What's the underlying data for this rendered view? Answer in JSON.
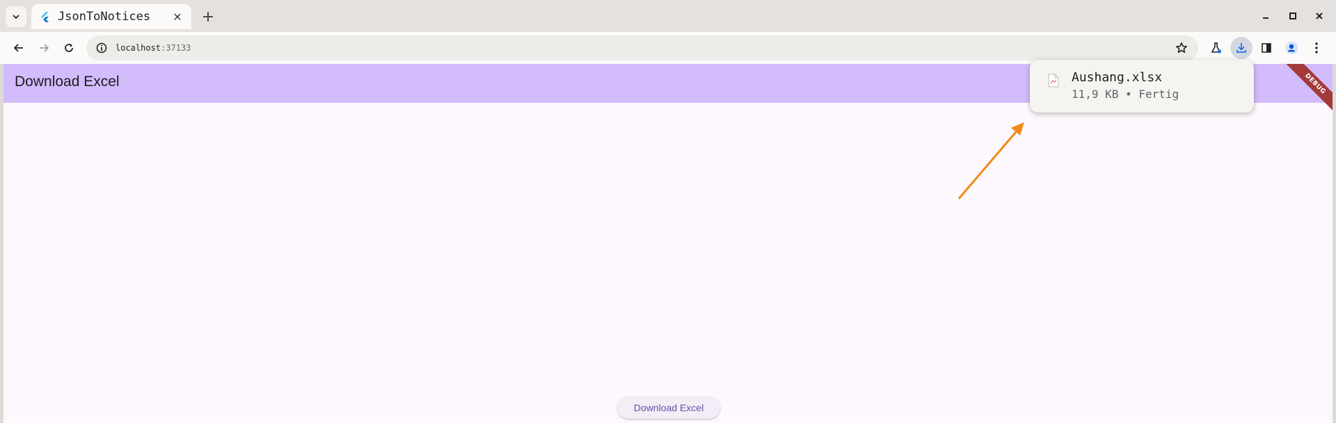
{
  "browser": {
    "tab": {
      "title": "JsonToNotices"
    },
    "address": {
      "host": "localhost",
      "port": ":37133"
    }
  },
  "app": {
    "appbar_title": "Download Excel",
    "debug_banner": "DEBUG",
    "download_button_label": "Download Excel"
  },
  "download_bubble": {
    "filename": "Aushang.xlsx",
    "status": "11,9 KB • Fertig"
  },
  "colors": {
    "appbar": "#d2bcfc",
    "page_background": "#fdf8fd",
    "annotation_arrow": "#f08a18",
    "debug_banner": "#a33a3a"
  },
  "icons": [
    "tab-search-icon",
    "flutter-favicon-icon",
    "close-icon",
    "plus-icon",
    "minimize-icon",
    "maximize-icon",
    "window-close-icon",
    "back-arrow-icon",
    "forward-arrow-icon",
    "reload-icon",
    "site-info-icon",
    "star-icon",
    "labs-flask-icon",
    "download-icon",
    "side-panel-icon",
    "profile-icon",
    "kebab-menu-icon",
    "file-icon"
  ]
}
